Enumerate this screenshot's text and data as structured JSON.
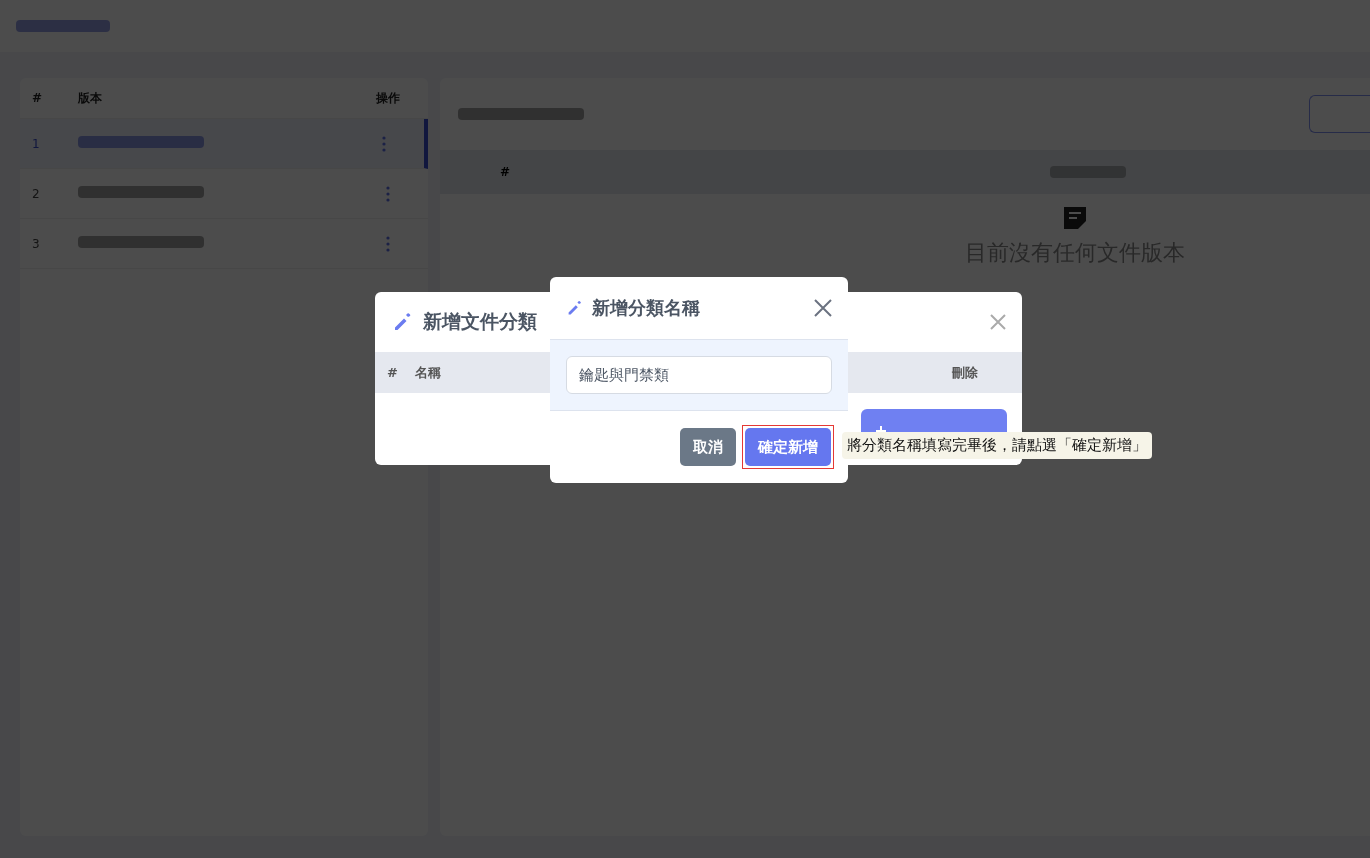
{
  "background": {
    "left_table": {
      "columns": [
        "#",
        "版本",
        "操作"
      ],
      "rows": [
        {
          "index": "1",
          "selected": true
        },
        {
          "index": "2",
          "selected": false
        },
        {
          "index": "3",
          "selected": false
        }
      ]
    },
    "right_panel": {
      "columns": [
        "#"
      ],
      "empty_message": "目前沒有任何文件版本"
    }
  },
  "category_dialog": {
    "title": "新增文件分類",
    "columns": [
      "#",
      "名稱",
      "刪除"
    ]
  },
  "name_dialog": {
    "title": "新增分類名稱",
    "value": "鑰匙與門禁類",
    "buttons": [
      {
        "label": "取消",
        "kind": "secondary"
      },
      {
        "label": "確定新增",
        "kind": "primary",
        "highlighted": true
      }
    ]
  },
  "tooltip": "將分類名稱填寫完畢後，請點選「確定新增」"
}
